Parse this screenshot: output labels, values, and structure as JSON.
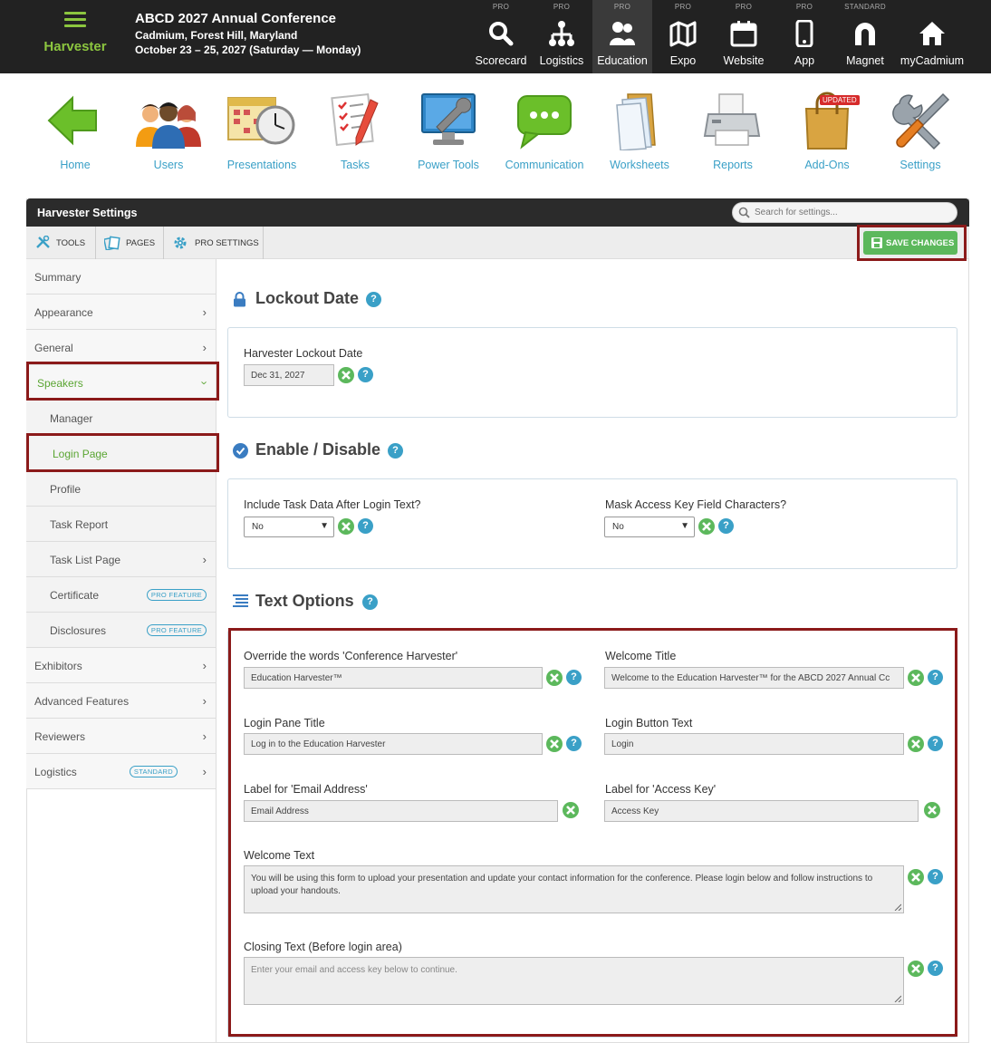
{
  "topbar": {
    "brand": "Harvester",
    "conference_title": "ABCD 2027 Annual Conference",
    "location": "Cadmium, Forest Hill, Maryland",
    "dates": "October 23 – 25, 2027 (Saturday — Monday)",
    "modules": [
      {
        "tier": "PRO",
        "label": "Scorecard",
        "icon": "search-icon"
      },
      {
        "tier": "PRO",
        "label": "Logistics",
        "icon": "hierarchy-icon"
      },
      {
        "tier": "PRO",
        "label": "Education",
        "icon": "people-icon",
        "active": true
      },
      {
        "tier": "PRO",
        "label": "Expo",
        "icon": "map-icon"
      },
      {
        "tier": "PRO",
        "label": "Website",
        "icon": "calendar-icon"
      },
      {
        "tier": "PRO",
        "label": "App",
        "icon": "phone-icon"
      },
      {
        "tier": "STANDARD",
        "label": "Magnet",
        "icon": "magnet-icon"
      },
      {
        "tier": "",
        "label": "myCadmium",
        "icon": "home-icon"
      }
    ]
  },
  "icon_nav": [
    {
      "label": "Home",
      "icon": "arrow-left-icon"
    },
    {
      "label": "Users",
      "icon": "users-icon"
    },
    {
      "label": "Presentations",
      "icon": "calendar-clock-icon"
    },
    {
      "label": "Tasks",
      "icon": "checklist-icon"
    },
    {
      "label": "Power Tools",
      "icon": "monitor-wrench-icon"
    },
    {
      "label": "Communication",
      "icon": "chat-bubble-icon"
    },
    {
      "label": "Worksheets",
      "icon": "folder-icon"
    },
    {
      "label": "Reports",
      "icon": "printer-icon"
    },
    {
      "label": "Add-Ons",
      "icon": "shopping-bag-icon",
      "badge": "UPDATED"
    },
    {
      "label": "Settings",
      "icon": "tools-icon"
    }
  ],
  "panel": {
    "title": "Harvester Settings",
    "search_placeholder": "Search for settings...",
    "tabs": [
      "TOOLS",
      "PAGES",
      "PRO SETTINGS"
    ],
    "save_label": "SAVE CHANGES"
  },
  "sidebar": {
    "items": [
      {
        "label": "Summary"
      },
      {
        "label": "Appearance"
      },
      {
        "label": "General"
      },
      {
        "label": "Speakers"
      },
      {
        "label": "Manager"
      },
      {
        "label": "Login Page"
      },
      {
        "label": "Profile"
      },
      {
        "label": "Task Report"
      },
      {
        "label": "Task List Page"
      },
      {
        "label": "Certificate",
        "tag": "PRO FEATURE"
      },
      {
        "label": "Disclosures",
        "tag": "PRO FEATURE"
      },
      {
        "label": "Exhibitors"
      },
      {
        "label": "Advanced Features"
      },
      {
        "label": "Reviewers"
      },
      {
        "label": "Logistics",
        "tag": "STANDARD"
      }
    ]
  },
  "sections": {
    "lockout": {
      "title": "Lockout Date",
      "field_label": "Harvester Lockout Date",
      "value": "Dec 31, 2027"
    },
    "enable": {
      "title": "Enable / Disable",
      "task_label": "Include Task Data After Login Text?",
      "task_value": "No",
      "mask_label": "Mask Access Key Field Characters?",
      "mask_value": "No"
    },
    "text": {
      "title": "Text Options",
      "override_label": "Override the words 'Conference Harvester'",
      "override_value": "Education Harvester™",
      "welcome_title_label": "Welcome Title",
      "welcome_title_value": "Welcome to the Education Harvester™ for the ABCD 2027 Annual Cc",
      "pane_title_label": "Login Pane Title",
      "pane_title_value": "Log in to the Education Harvester",
      "button_text_label": "Login Button Text",
      "button_text_value": "Login",
      "email_label": "Label for 'Email Address'",
      "email_value": "Email Address",
      "access_label": "Label for 'Access Key'",
      "access_value": "Access Key",
      "welcome_text_label": "Welcome Text",
      "welcome_text_value": "You will be using this form to upload your presentation and update your contact information for the conference.  Please login below and follow instructions to upload your handouts.",
      "closing_label": "Closing Text (Before login area)",
      "closing_placeholder": "Enter your email and access key below to continue."
    }
  },
  "help_glyph": "?"
}
